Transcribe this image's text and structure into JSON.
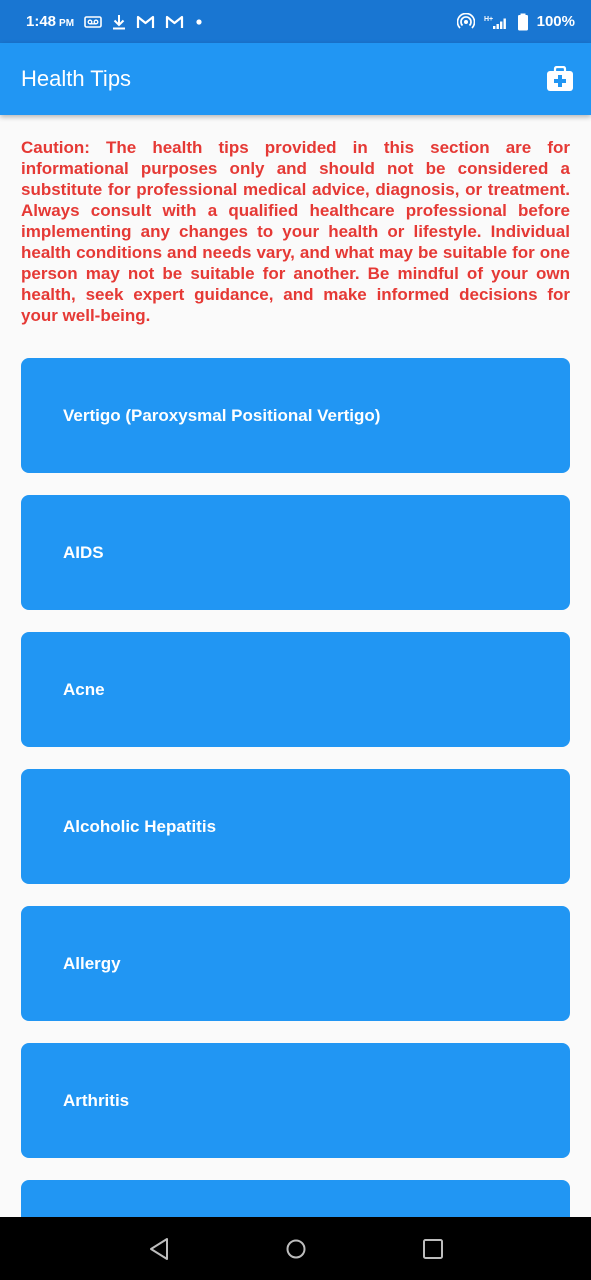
{
  "status_bar": {
    "time": "1:48",
    "ampm": "PM",
    "network": "H+",
    "battery": "100%",
    "icons": [
      "voicemail-icon",
      "download-icon",
      "gmail-icon",
      "gmail-icon",
      "dot-icon",
      "hotspot-icon",
      "signal-icon",
      "battery-icon"
    ]
  },
  "app_bar": {
    "title": "Health Tips",
    "action_icon": "medical-kit-icon"
  },
  "caution": "Caution: The health tips provided in this section are for informational purposes only and should not be considered a substitute for professional medical advice, diagnosis, or treatment. Always consult with a qualified healthcare professional before implementing any changes to your health or lifestyle. Individual health conditions and needs vary, and what may be suitable for one person may not be suitable for another. Be mindful of your own health, seek expert guidance, and make informed decisions for your well-being.",
  "tips": [
    {
      "label": "Vertigo (Paroxysmal Positional Vertigo)"
    },
    {
      "label": "AIDS"
    },
    {
      "label": "Acne"
    },
    {
      "label": "Alcoholic Hepatitis"
    },
    {
      "label": "Allergy"
    },
    {
      "label": "Arthritis"
    },
    {
      "label": ""
    }
  ],
  "nav_bar": {
    "back": "back-icon",
    "home": "home-icon",
    "recents": "recents-icon"
  },
  "colors": {
    "status_bar": "#1976d2",
    "app_bar": "#2196f3",
    "card": "#2196f3",
    "caution_text": "#e53935",
    "background": "#fafafa"
  }
}
